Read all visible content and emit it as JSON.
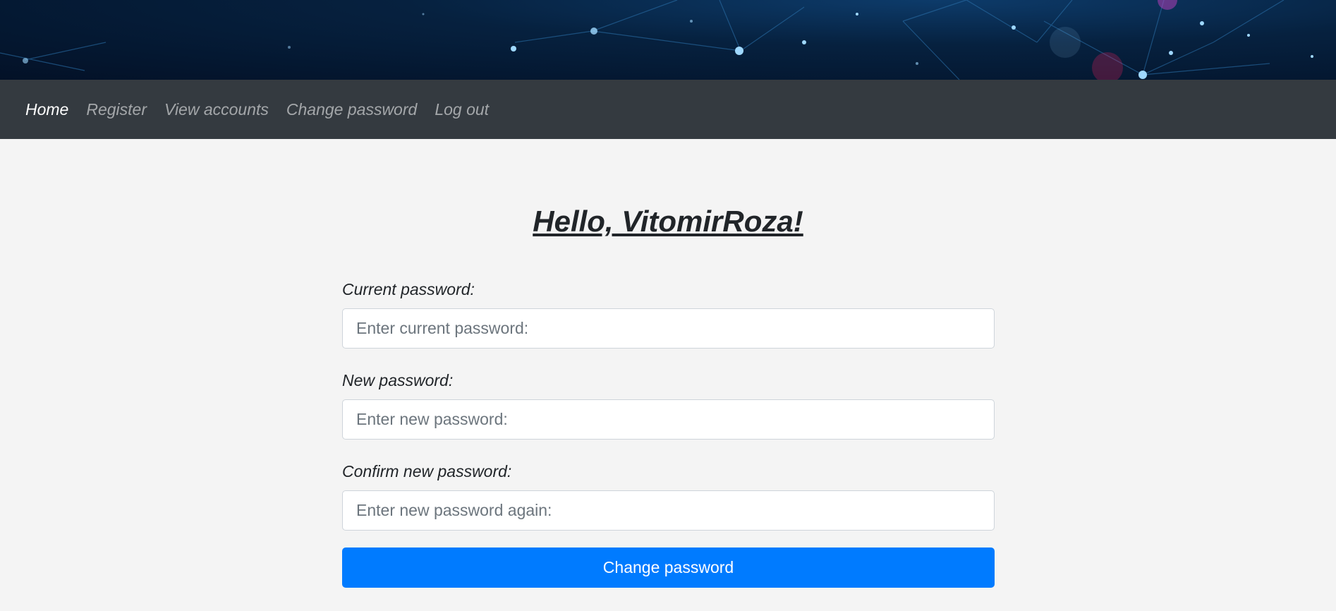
{
  "nav": {
    "items": [
      {
        "label": "Home",
        "active": true
      },
      {
        "label": "Register",
        "active": false
      },
      {
        "label": "View accounts",
        "active": false
      },
      {
        "label": "Change password",
        "active": false
      },
      {
        "label": "Log out",
        "active": false
      }
    ]
  },
  "main": {
    "title": "Hello, VitomirRoza!",
    "fields": [
      {
        "label": "Current password:",
        "placeholder": "Enter current password:",
        "value": ""
      },
      {
        "label": "New password:",
        "placeholder": "Enter new password:",
        "value": ""
      },
      {
        "label": "Confirm new password:",
        "placeholder": "Enter new password again:",
        "value": ""
      }
    ],
    "submit_label": "Change password"
  },
  "colors": {
    "navbar": "#343a40",
    "primary": "#007bff",
    "background": "#f4f4f4"
  }
}
